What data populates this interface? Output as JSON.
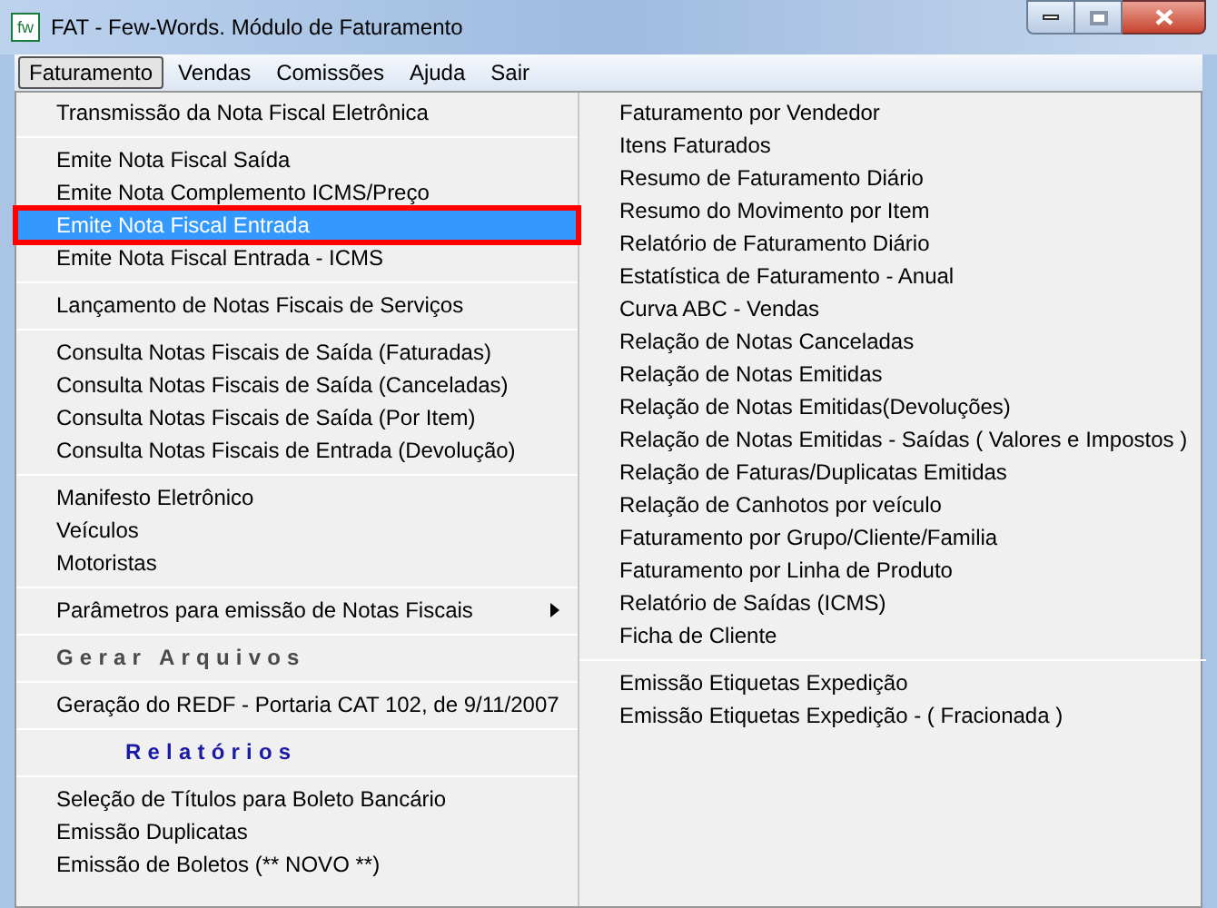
{
  "window": {
    "title": "FAT - Few-Words. Módulo de Faturamento",
    "icon_text": "fw"
  },
  "menubar": [
    {
      "label": "Faturamento",
      "selected": true
    },
    {
      "label": "Vendas",
      "selected": false
    },
    {
      "label": "Comissões",
      "selected": false
    },
    {
      "label": "Ajuda",
      "selected": false
    },
    {
      "label": "Sair",
      "selected": false
    }
  ],
  "menu_left": [
    {
      "kind": "item",
      "label": "Transmissão da Nota Fiscal Eletrônica",
      "selected": false,
      "outlined": false,
      "submenu": false
    },
    {
      "kind": "separator"
    },
    {
      "kind": "item",
      "label": "Emite Nota Fiscal Saída",
      "selected": false,
      "outlined": false,
      "submenu": false
    },
    {
      "kind": "item",
      "label": "Emite Nota Complemento ICMS/Preço",
      "selected": false,
      "outlined": false,
      "submenu": false
    },
    {
      "kind": "item",
      "label": "Emite Nota Fiscal Entrada",
      "selected": true,
      "outlined": true
    },
    {
      "kind": "item",
      "label": "Emite Nota Fiscal Entrada - ICMS",
      "selected": false,
      "outlined": false,
      "submenu": false
    },
    {
      "kind": "separator"
    },
    {
      "kind": "item",
      "label": "Lançamento de Notas Fiscais de Serviços",
      "selected": false,
      "outlined": false,
      "submenu": false
    },
    {
      "kind": "separator"
    },
    {
      "kind": "item",
      "label": "Consulta Notas Fiscais de Saída (Faturadas)",
      "selected": false,
      "outlined": false,
      "submenu": false
    },
    {
      "kind": "item",
      "label": "Consulta Notas Fiscais de Saída (Canceladas)",
      "selected": false,
      "outlined": false,
      "submenu": false
    },
    {
      "kind": "item",
      "label": "Consulta Notas Fiscais de Saída (Por Item)",
      "selected": false,
      "outlined": false,
      "submenu": false
    },
    {
      "kind": "item",
      "label": "Consulta Notas Fiscais de Entrada (Devolução)",
      "selected": false,
      "outlined": false,
      "submenu": false
    },
    {
      "kind": "separator"
    },
    {
      "kind": "item",
      "label": "Manifesto Eletrônico",
      "selected": false,
      "outlined": false,
      "submenu": false
    },
    {
      "kind": "item",
      "label": "Veículos",
      "selected": false,
      "outlined": false,
      "submenu": false
    },
    {
      "kind": "item",
      "label": "Motoristas",
      "selected": false,
      "outlined": false,
      "submenu": false
    },
    {
      "kind": "separator"
    },
    {
      "kind": "item",
      "label": "Parâmetros para emissão de Notas Fiscais",
      "selected": false,
      "submenu": true
    },
    {
      "kind": "separator"
    },
    {
      "kind": "heading_gray",
      "label": "Gerar Arquivos"
    },
    {
      "kind": "separator"
    },
    {
      "kind": "item",
      "label": "Geração do REDF - Portaria CAT 102, de 9/11/2007",
      "selected": false,
      "outlined": false,
      "submenu": false
    },
    {
      "kind": "separator"
    },
    {
      "kind": "heading_blue",
      "label": "Relatórios"
    },
    {
      "kind": "separator"
    },
    {
      "kind": "item",
      "label": "Seleção de Títulos para Boleto Bancário",
      "selected": false,
      "outlined": false,
      "submenu": false
    },
    {
      "kind": "item",
      "label": "Emissão Duplicatas",
      "selected": false,
      "outlined": false,
      "submenu": false
    },
    {
      "kind": "item",
      "label": "Emissão de Boletos (** NOVO **)",
      "selected": false,
      "outlined": false,
      "submenu": false
    }
  ],
  "menu_right": [
    {
      "kind": "item",
      "label": "Faturamento por Vendedor"
    },
    {
      "kind": "item",
      "label": "Itens Faturados"
    },
    {
      "kind": "item",
      "label": "Resumo de Faturamento Diário"
    },
    {
      "kind": "item",
      "label": "Resumo do Movimento por Item"
    },
    {
      "kind": "item",
      "label": "Relatório de Faturamento Diário"
    },
    {
      "kind": "item",
      "label": "Estatística de Faturamento - Anual"
    },
    {
      "kind": "item",
      "label": "Curva ABC - Vendas"
    },
    {
      "kind": "item",
      "label": "Relação de Notas Canceladas"
    },
    {
      "kind": "item",
      "label": "Relação de Notas Emitidas"
    },
    {
      "kind": "item",
      "label": "Relação de Notas Emitidas(Devoluções)"
    },
    {
      "kind": "item",
      "label": "Relação de Notas Emitidas - Saídas ( Valores e Impostos )"
    },
    {
      "kind": "item",
      "label": "Relação de Faturas/Duplicatas Emitidas"
    },
    {
      "kind": "item",
      "label": "Relação de Canhotos por veículo"
    },
    {
      "kind": "item",
      "label": "Faturamento por Grupo/Cliente/Familia"
    },
    {
      "kind": "item",
      "label": "Faturamento por Linha de Produto"
    },
    {
      "kind": "item",
      "label": "Relatório de  Saídas (ICMS)"
    },
    {
      "kind": "item",
      "label": "Ficha de Cliente"
    },
    {
      "kind": "separator"
    },
    {
      "kind": "item",
      "label": "Emissão Etiquetas Expedição"
    },
    {
      "kind": "item",
      "label": "Emissão Etiquetas Expedição - ( Fracionada )"
    }
  ]
}
